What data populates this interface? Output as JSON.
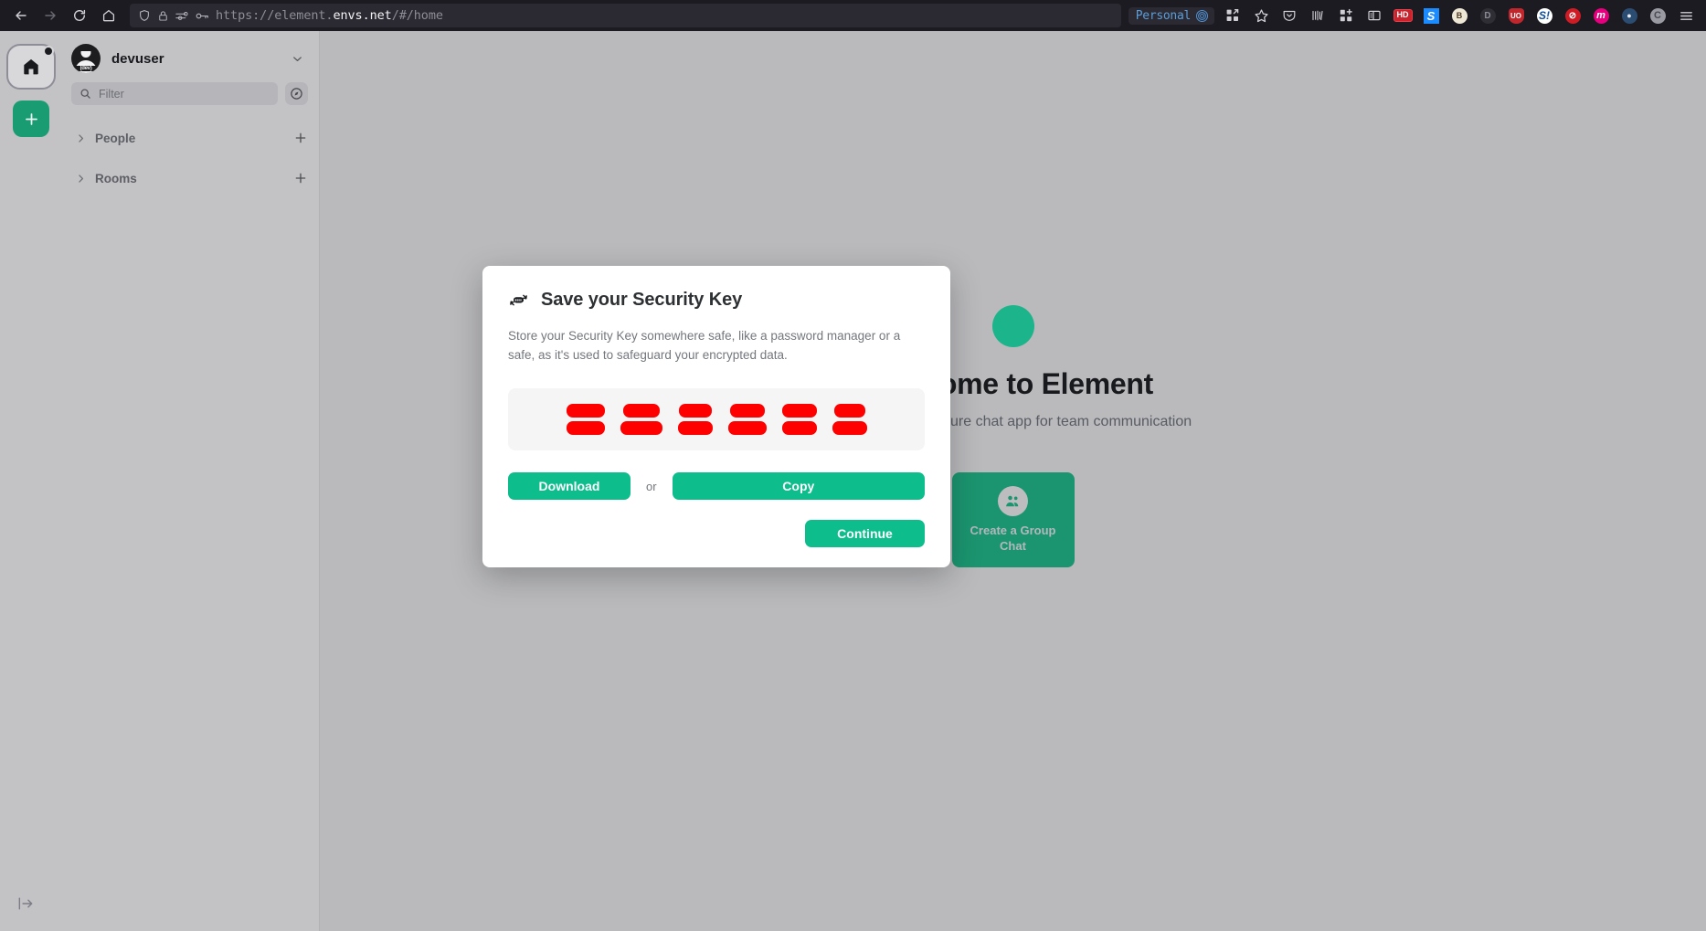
{
  "browser": {
    "back_icon": "back-arrow-icon",
    "forward_icon": "forward-arrow-icon",
    "reload_icon": "reload-icon",
    "home_icon": "home-icon",
    "url_prefix": "https://element.",
    "url_domain": "envs.net",
    "url_suffix": "/#/home",
    "url_full": "https://element.envs.net/#/home",
    "shield_icon": "shield-icon",
    "lock_icon": "lock-icon",
    "permissions_icon": "page-settings-icon",
    "key_icon": "key-icon",
    "container_label": "Personal",
    "container_icon": "fingerprint-icon",
    "extensions_icon": "extensions-grid-icon",
    "bookmark_icon": "star-icon",
    "pocket_icon": "pocket-icon",
    "bars_icon": "vertical-bars-icon",
    "grid_add_icon": "grid-add-icon",
    "sidebar_icon": "sidebar-panel-icon",
    "hd_badge": "HD",
    "s_badge": "S",
    "badger_badge": "B",
    "d_badge": "D",
    "uo_badge": "UO",
    "s2_badge": "S!",
    "block_badge": "⊘",
    "m_badge": "m",
    "blue_badge": "●",
    "c_badge": "C",
    "menu_icon": "hamburger-menu-icon"
  },
  "spaces": {
    "home_label": "Home space",
    "home_icon": "home-icon",
    "add_icon": "plus-icon",
    "add_label": "Create a space",
    "expand_icon": "expand-sidebar-icon"
  },
  "roomlist": {
    "user_name": "devuser",
    "avatar_label": "(dev)",
    "chevron_icon": "chevron-down-icon",
    "search_placeholder": "Filter",
    "search_icon": "search-icon",
    "explore_icon": "compass-icon",
    "sections": [
      {
        "label": "People",
        "chevron": "chevron-right-icon",
        "add_icon": "plus-icon"
      },
      {
        "label": "Rooms",
        "chevron": "chevron-right-icon",
        "add_icon": "plus-icon"
      }
    ]
  },
  "home": {
    "title": "Welcome to Element",
    "subtitle": "The all-in-one secure chat app for team communication",
    "tiles": [
      {
        "label": "Create a Group Chat",
        "icon": "group-people-icon"
      }
    ]
  },
  "modal": {
    "icon": "security-key-restore-icon",
    "title": "Save your Security Key",
    "body": "Store your Security Key somewhere safe, like a password manager or a safe, as it's used to safeguard your encrypted data.",
    "security_key_redacted": true,
    "security_key_rows": 2,
    "security_key_columns": 6,
    "security_key_block_widths": [
      [
        42,
        40,
        36,
        38,
        38,
        34
      ],
      [
        42,
        46,
        38,
        42,
        38,
        38
      ]
    ],
    "download_label": "Download",
    "or_label": "or",
    "copy_label": "Copy",
    "continue_label": "Continue"
  },
  "colors": {
    "accent_green": "#0DBD8B",
    "tile_green": "#1A9C73",
    "redaction_red": "#FE0000",
    "chrome_dark": "#1C1B22",
    "app_bg": "#C3C3C5"
  }
}
